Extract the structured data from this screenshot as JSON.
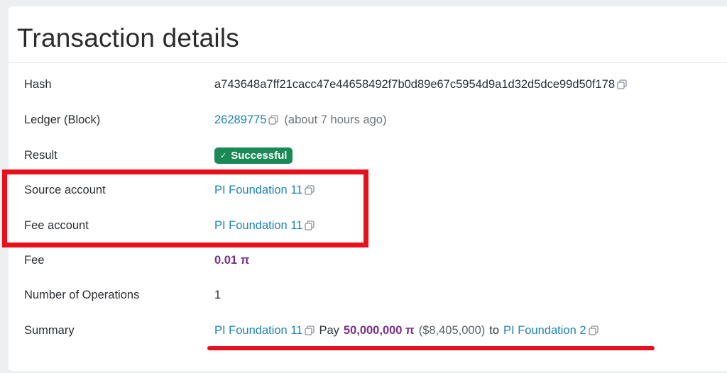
{
  "page": {
    "title": "Transaction details"
  },
  "rows": {
    "hash": {
      "label": "Hash",
      "value": "a743648a7ff21cacc47e44658492f7b0d89e67c5954d9a1d32d5dce99d50f178"
    },
    "ledger": {
      "label": "Ledger (Block)",
      "block": "26289775",
      "age": "(about 7 hours ago)"
    },
    "result": {
      "label": "Result",
      "check": "✓",
      "status": "Successful"
    },
    "source_account": {
      "label": "Source account",
      "value": "PI Foundation 11"
    },
    "fee_account": {
      "label": "Fee account",
      "value": "PI Foundation 11"
    },
    "fee": {
      "label": "Fee",
      "value": "0.01 π"
    },
    "operations": {
      "label": "Number of Operations",
      "value": "1"
    },
    "summary": {
      "label": "Summary",
      "from": "PI Foundation 11",
      "verb": "Pay",
      "amount": "50,000,000 π",
      "usd": "($8,405,000)",
      "to_word": "to",
      "to": "PI Foundation 2"
    }
  },
  "icons": {
    "copy": "copy-icon",
    "check": "check-icon"
  },
  "colors": {
    "link": "#1b83b8",
    "amount": "#7a2e8c",
    "success": "#198a56",
    "annotation": "#e8101b"
  }
}
